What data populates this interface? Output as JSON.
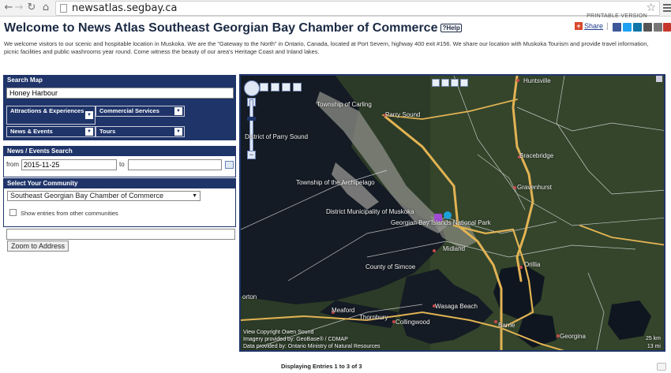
{
  "browser": {
    "url": "newsatlas.segbay.ca",
    "back_icon": "back-arrow-icon",
    "forward_icon": "forward-arrow-icon",
    "reload_icon": "reload-icon",
    "home_icon": "home-icon",
    "star_icon": "bookmark-star-icon",
    "menu_icon": "hamburger-menu-icon"
  },
  "header": {
    "printable_label": "PRINTABLE VERSION",
    "title": "Welcome to News Atlas Southeast Georgian Bay Chamber of Commerce",
    "help_label": "?Help",
    "share_label": "Share",
    "separator": "|",
    "social_icons": [
      {
        "name": "facebook-icon",
        "color": "#3b5998"
      },
      {
        "name": "twitter-icon",
        "color": "#1da1f2"
      },
      {
        "name": "linkedin-icon",
        "color": "#0e76a8"
      },
      {
        "name": "email-icon",
        "color": "#555555"
      },
      {
        "name": "print-icon",
        "color": "#777777"
      },
      {
        "name": "gmail-icon",
        "color": "#c7362b"
      }
    ],
    "intro": "We welcome visitors to our scenic and hospitable location in Muskoka. We are the \"Gateway to the North\" in Ontario, Canada, located at Port Severn, highway 400 exit #156. We share our location with Muskoka Tourism and provide travel information, picnic facilities and public washrooms year round. Come witness the beauty of our area's Heritage Coast and Inland lakes."
  },
  "search_map": {
    "heading": "Search Map",
    "query": "Honey Harbour",
    "categories": [
      {
        "label": "Attractions & Experiences"
      },
      {
        "label": "Commercial Services"
      },
      {
        "label": "News & Events"
      },
      {
        "label": "Tours"
      }
    ]
  },
  "events_search": {
    "heading": "News / Events Search",
    "from_label": "from",
    "from_value": "2015-11-25",
    "to_label": "to",
    "to_value": ""
  },
  "community": {
    "heading": "Select Your Community",
    "selected": "Southeast Georgian Bay Chamber of Commerce",
    "show_other_label": "Show entries from other communities"
  },
  "address": {
    "value": "",
    "zoom_label": "Zoom to Address"
  },
  "map": {
    "labels": [
      "Huntsville",
      "Township of Carling",
      "Parry Sound",
      "District of Parry Sound",
      "Bracebridge",
      "Gravenhurst",
      "Township of the Archipelago",
      "District Municipality of Muskoka",
      "Georgian Bay Islands National Park",
      "Midland",
      "Orillia",
      "County of Simcoe",
      "Wasaga Beach",
      "Meaford",
      "Thornbury",
      "Collingwood",
      "Barrie",
      "Georgina",
      "orton"
    ],
    "credits": [
      "View Copyright Owen Sound",
      "Imagery provided by: GeoBase® / CDMAP",
      "Data provided by: Ontario Ministry of Natural Resources"
    ],
    "scale_km": "25 km",
    "scale_mi": "13 mi"
  },
  "footer": {
    "entries_text": "Displaying Entries 1 to 3 of 3"
  }
}
